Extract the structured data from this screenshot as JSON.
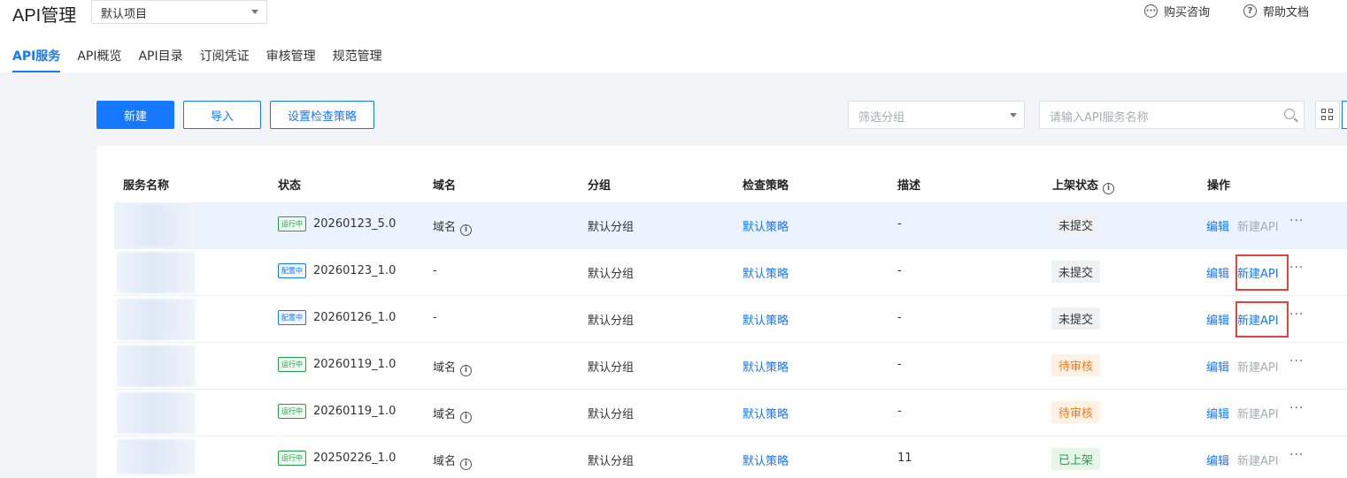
{
  "app": {
    "title": "API管理",
    "project_selector_value": "默认项目",
    "links": [
      {
        "label": "购买咨询",
        "icon": "chat-icon"
      },
      {
        "label": "帮助文档",
        "icon": "help-icon"
      }
    ]
  },
  "tabs": [
    {
      "label": "API服务",
      "active": true
    },
    {
      "label": "API概览",
      "active": false
    },
    {
      "label": "API目录",
      "active": false
    },
    {
      "label": "订阅凭证",
      "active": false
    },
    {
      "label": "审核管理",
      "active": false
    },
    {
      "label": "规范管理",
      "active": false
    }
  ],
  "toolbar": {
    "new_label": "新建",
    "import_label": "导入",
    "policy_label": "设置检查策略",
    "group_filter_placeholder": "筛选分组",
    "search_placeholder": "请输入API服务名称"
  },
  "table": {
    "columns": [
      "服务名称",
      "状态",
      "域名",
      "分组",
      "检查策略",
      "描述",
      "上架状态",
      "操作"
    ],
    "rows": [
      {
        "status_tag": "运行中",
        "version": "20260123_5.0",
        "domain": "域名",
        "group": "默认分组",
        "policy": "默认策略",
        "desc": "-",
        "publish": "未提交",
        "edit": "编辑",
        "new_api": "新建API",
        "new_api_enabled": false,
        "more": "···"
      },
      {
        "status_tag": "配置中",
        "version": "20260123_1.0",
        "domain": "-",
        "group": "默认分组",
        "policy": "默认策略",
        "desc": "-",
        "publish": "未提交",
        "edit": "编辑",
        "new_api": "新建API",
        "new_api_enabled": true,
        "more": "···"
      },
      {
        "status_tag": "配置中",
        "version": "20260126_1.0",
        "domain": "-",
        "group": "默认分组",
        "policy": "默认策略",
        "desc": "-",
        "publish": "未提交",
        "edit": "编辑",
        "new_api": "新建API",
        "new_api_enabled": true,
        "more": "···"
      },
      {
        "status_tag": "运行中",
        "version": "20260119_1.0",
        "domain": "域名",
        "group": "默认分组",
        "policy": "默认策略",
        "desc": "-",
        "publish": "待审核",
        "edit": "编辑",
        "new_api": "新建API",
        "new_api_enabled": false,
        "more": "···"
      },
      {
        "status_tag": "运行中",
        "version": "20260119_1.0",
        "domain": "域名",
        "group": "默认分组",
        "policy": "默认策略",
        "desc": "-",
        "publish": "待审核",
        "edit": "编辑",
        "new_api": "新建API",
        "new_api_enabled": false,
        "more": "···"
      },
      {
        "status_tag": "运行中",
        "version": "20250226_1.0",
        "domain": "域名",
        "group": "默认分组",
        "policy": "默认策略",
        "desc": "11",
        "publish": "已上架",
        "edit": "编辑",
        "new_api": "新建API",
        "new_api_enabled": false,
        "more": "···"
      }
    ]
  }
}
